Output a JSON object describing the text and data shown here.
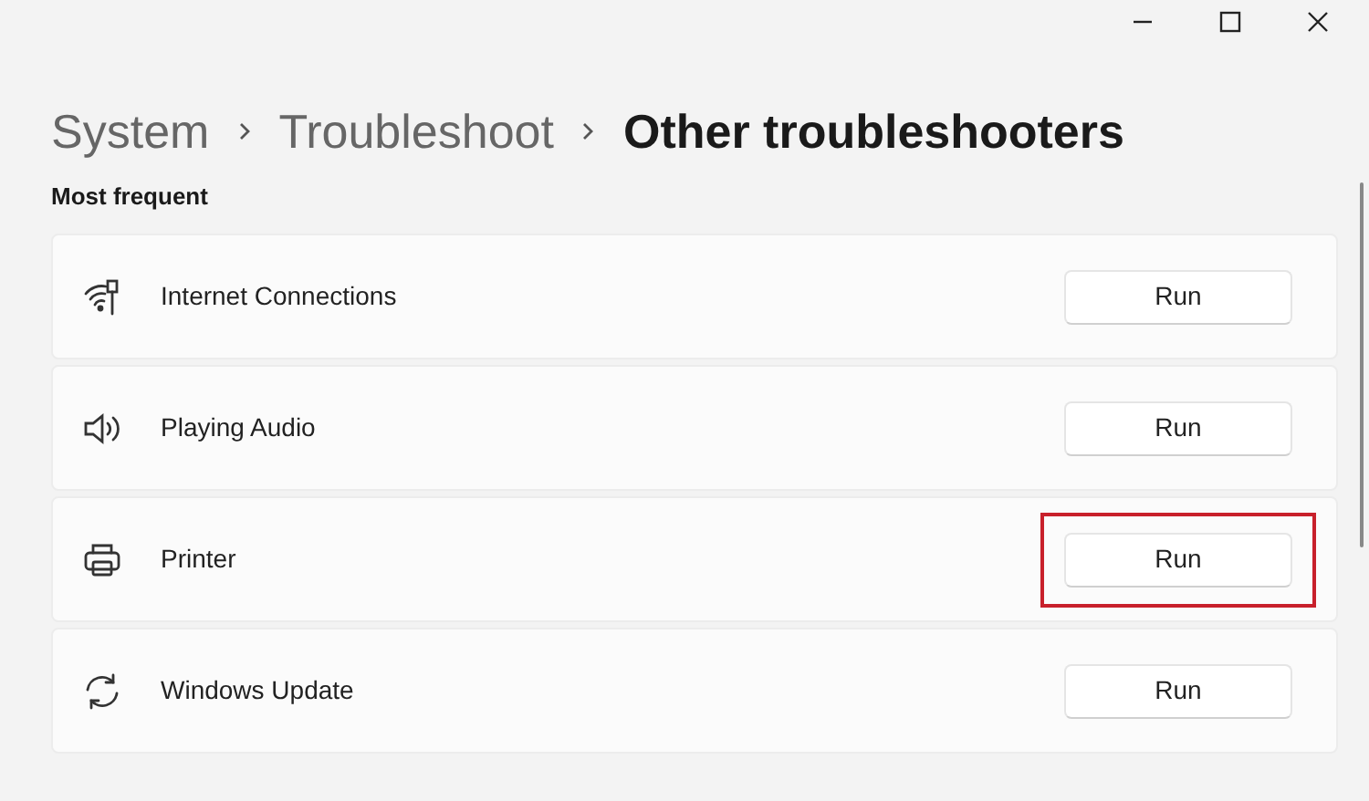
{
  "window_controls": [
    {
      "kind": "minimize"
    },
    {
      "kind": "maximize"
    },
    {
      "kind": "close"
    }
  ],
  "breadcrumb": [
    {
      "label": "System",
      "current": false
    },
    {
      "label": "Troubleshoot",
      "current": false
    },
    {
      "label": "Other troubleshooters",
      "current": true
    }
  ],
  "section_title": "Most frequent",
  "troubleshooters": [
    {
      "kind": "wifi",
      "name": "Internet Connections",
      "button": "Run",
      "highlighted": false
    },
    {
      "kind": "audio",
      "name": "Playing Audio",
      "button": "Run",
      "highlighted": false
    },
    {
      "kind": "printer",
      "name": "Printer",
      "button": "Run",
      "highlighted": true
    },
    {
      "kind": "update",
      "name": "Windows Update",
      "button": "Run",
      "highlighted": false
    }
  ]
}
